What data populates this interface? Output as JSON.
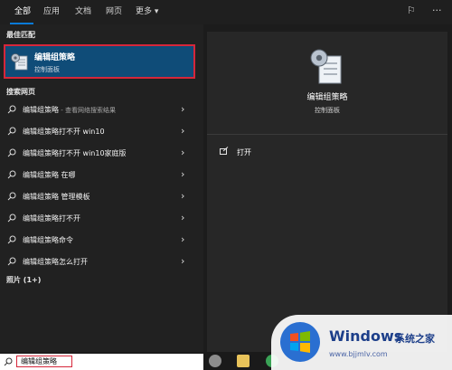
{
  "tabs": [
    {
      "label": "全部",
      "active": true
    },
    {
      "label": "应用"
    },
    {
      "label": "文档"
    },
    {
      "label": "网页"
    },
    {
      "label": "更多"
    }
  ],
  "best_match": {
    "section": "最佳匹配",
    "title": "编辑组策略",
    "subtitle": "控制面板"
  },
  "web": {
    "section": "搜索网页",
    "items": [
      {
        "label": "编辑组策略",
        "sub": " - 查看网络搜索结果"
      },
      {
        "label": "编辑组策略打不开 win10",
        "sub": ""
      },
      {
        "label": "编辑组策略打不开 win10家庭版",
        "sub": ""
      },
      {
        "label": "编辑组策略 在哪",
        "sub": ""
      },
      {
        "label": "编辑组策略 管理模板",
        "sub": ""
      },
      {
        "label": "编辑组策略打不开",
        "sub": ""
      },
      {
        "label": "编辑组策略命令",
        "sub": ""
      },
      {
        "label": "编辑组策略怎么打开",
        "sub": ""
      }
    ]
  },
  "photos": {
    "section": "照片 (1+)"
  },
  "detail": {
    "title": "编辑组策略",
    "subtitle": "控制面板",
    "action_open": "打开"
  },
  "search": {
    "query": "编辑组策略"
  },
  "watermark": {
    "brand": "Windows",
    "cn": "系统之家",
    "url": "www.bjjmlv.com"
  },
  "colors": {
    "accent": "#0a7ad8",
    "highlight": "#0f4c78",
    "annotation": "#d6263a"
  }
}
